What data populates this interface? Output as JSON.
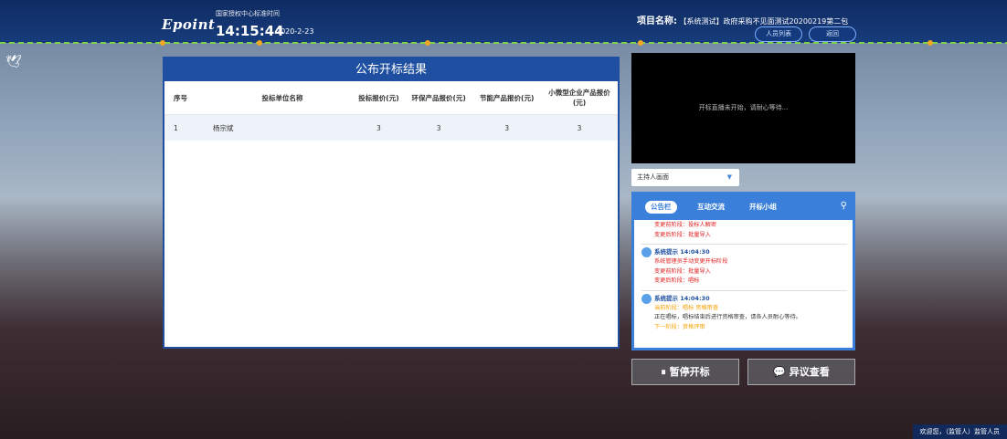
{
  "header": {
    "logo": "Epoint",
    "clock_label": "国家授权中心标准时间",
    "time": "14:15:44",
    "date": "2020-2-23",
    "project_label": "项目名称:",
    "project_name": "【系统测试】政府采购不见面测试20200219第二包",
    "btn_people": "人员列表",
    "btn_back": "返回"
  },
  "panel": {
    "title": "公布开标结果",
    "columns": [
      "序号",
      "投标单位名称",
      "投标报价(元)",
      "环保产品报价(元)",
      "节能产品报价(元)",
      "小微型企业产品报价(元)"
    ],
    "rows": [
      {
        "no": "1",
        "name": "杨宗斌",
        "bid": "3",
        "eco": "3",
        "energy": "3",
        "small": "3"
      }
    ]
  },
  "video": {
    "status": "开标直播未开始，请耐心等待..."
  },
  "select": {
    "value": "主持人画面"
  },
  "chat": {
    "tabs": [
      "公告栏",
      "互动交流",
      "开标小组"
    ],
    "lines_top": [
      "变更前阶段：投标人解密",
      "变更后阶段：批量导入"
    ],
    "msg1": {
      "title": "系统提示 14:04:30",
      "line1": "系统管理员手动变更开标阶段",
      "line2": "变更前阶段：批量导入",
      "line3": "变更后阶段：唱标"
    },
    "msg2": {
      "title": "系统提示 14:04:30",
      "line1": "当前阶段：唱标 资格审查",
      "line2": "正在唱标，唱标结束后进行资格审查，请各人员耐心等待。",
      "line3": "下一阶段：资格评审"
    }
  },
  "buttons": {
    "pause": "暂停开标",
    "objection": "异议查看"
  },
  "footer": {
    "welcome": "欢迎您，（监管人）监管人员"
  }
}
